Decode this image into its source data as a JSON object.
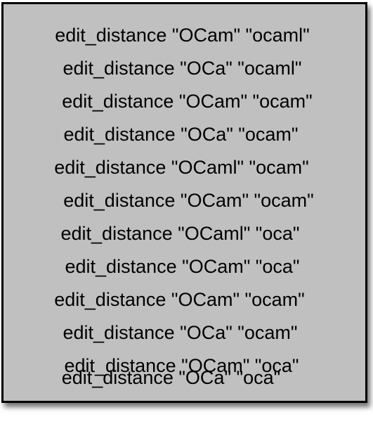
{
  "colors": {
    "box_fill": "#c0c0c0",
    "box_border": "#000000",
    "text": "#000000"
  },
  "lines": [
    "edit_distance \"OCam\" \"ocaml\"",
    "edit_distance \"OCa\" \"ocaml\"",
    "edit_distance \"OCam\" \"ocam\"",
    "edit_distance \"OCa\" \"ocam\"",
    "edit_distance \"OCaml\" \"ocam\"",
    "edit_distance \"OCam\" \"ocam\"",
    "edit_distance \"OCaml\" \"oca\"",
    "edit_distance \"OCam\" \"oca\"",
    "edit_distance \"OCam\" \"ocam\"",
    "edit_distance \"OCa\" \"ocam\"",
    "edit_distance \"OCam\" \"oca\"",
    "edit_distance \"OCa\" \"oca\""
  ]
}
